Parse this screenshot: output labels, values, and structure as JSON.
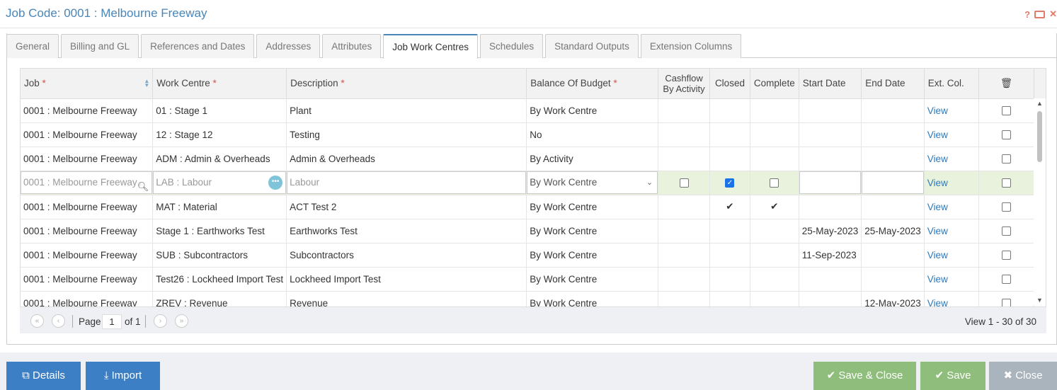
{
  "title": "Job Code: 0001 : Melbourne Freeway",
  "title_icons": [
    "help-icon",
    "table-icon",
    "close-icon"
  ],
  "tabs": [
    "General",
    "Billing and GL",
    "References and Dates",
    "Addresses",
    "Attributes",
    "Job Work Centres",
    "Schedules",
    "Standard Outputs",
    "Extension Columns"
  ],
  "active_tab": "Job Work Centres",
  "grid": {
    "headers": {
      "job": "Job",
      "work_centre": "Work Centre",
      "description": "Description",
      "balance": "Balance Of Budget",
      "cashflow_1": "Cashflow",
      "cashflow_2": "By Activity",
      "closed": "Closed",
      "complete": "Complete",
      "start": "Start Date",
      "end": "End Date",
      "ext": "Ext. Col.",
      "req": "*"
    },
    "view_label": "View",
    "rows": [
      {
        "job": "0001 : Melbourne Freeway",
        "wc": "01 : Stage 1",
        "desc": "Plant",
        "bal": "By Work Centre",
        "start": "",
        "end": ""
      },
      {
        "job": "0001 : Melbourne Freeway",
        "wc": "12 : Stage 12",
        "desc": "Testing",
        "bal": "No",
        "start": "",
        "end": ""
      },
      {
        "job": "0001 : Melbourne Freeway",
        "wc": "ADM : Admin & Overheads",
        "desc": "Admin & Overheads",
        "bal": "By Activity",
        "start": "",
        "end": ""
      }
    ],
    "edit_row": {
      "job": "0001 : Melbourne Freeway",
      "wc": "LAB : Labour",
      "desc": "Labour",
      "bal": "By Work Centre",
      "cashflow": false,
      "closed": true,
      "complete": false
    },
    "rows2": [
      {
        "job": "0001 : Melbourne Freeway",
        "wc": "MAT : Material",
        "desc": "ACT Test 2",
        "bal": "By Work Centre",
        "closed": true,
        "complete": true,
        "start": "",
        "end": ""
      },
      {
        "job": "0001 : Melbourne Freeway",
        "wc": "Stage 1 : Earthworks Test",
        "desc": "Earthworks Test",
        "bal": "By Work Centre",
        "start": "25-May-2023",
        "end": "25-May-2023"
      },
      {
        "job": "0001 : Melbourne Freeway",
        "wc": "SUB : Subcontractors",
        "desc": "Subcontractors",
        "bal": "By Work Centre",
        "start": "11-Sep-2023",
        "end": ""
      },
      {
        "job": "0001 : Melbourne Freeway",
        "wc": "Test26 : Lockheed Import Test",
        "desc": "Lockheed Import Test",
        "bal": "By Work Centre",
        "start": "",
        "end": ""
      },
      {
        "job": "0001 : Melbourne Freeway",
        "wc": "ZREV : Revenue",
        "desc": "Revenue",
        "bal": "By Work Centre",
        "start": "",
        "end": "12-May-2023"
      }
    ]
  },
  "pager": {
    "page_label": "Page",
    "page": "1",
    "of_label": "of 1",
    "records": "View 1 - 30 of 30"
  },
  "footer": {
    "details": "Details",
    "import": "Import",
    "save_close": "Save & Close",
    "save": "Save",
    "close": "Close"
  }
}
